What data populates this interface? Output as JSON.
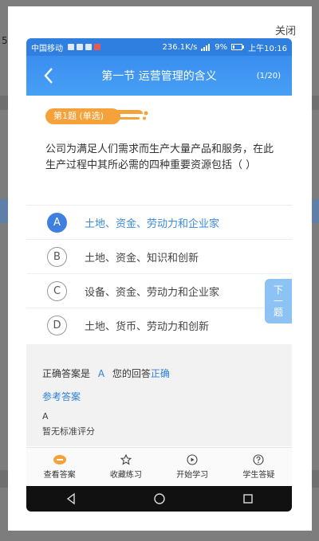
{
  "background": {
    "side_text": "5"
  },
  "modal": {
    "close_label": "关闭"
  },
  "status_bar": {
    "carrier": "中国移动",
    "net_speed": "236.1K/s",
    "battery": "9%",
    "time": "上午10:16"
  },
  "header": {
    "title": "第一节 运营管理的含义",
    "counter": "(1/20)"
  },
  "question": {
    "badge": "第1题 (单选)",
    "text": "公司为满足人们需求而生产大量产品和服务，在此生产过程中其所必需的四种重要资源包括（ ）",
    "options": [
      {
        "letter": "A",
        "text": "土地、资金、劳动力和企业家",
        "selected": true
      },
      {
        "letter": "B",
        "text": "土地、资金、知识和创新",
        "selected": false
      },
      {
        "letter": "C",
        "text": "设备、资金、劳动力和企业家",
        "selected": false
      },
      {
        "letter": "D",
        "text": "土地、货币、劳动力和创新",
        "selected": false
      }
    ],
    "next_label_1": "下",
    "next_label_2": "一",
    "next_label_3": "题"
  },
  "answer": {
    "correct_prefix": "正确答案是",
    "correct_letter": "A",
    "your_answer_prefix": "您的回答",
    "your_answer_result": "正确",
    "reference_label": "参考答案",
    "reference_value": "A",
    "scoring_note": "暂无标准评分"
  },
  "bottom_nav": {
    "items": [
      {
        "label": "查看答案",
        "icon": "answer-icon"
      },
      {
        "label": "收藏练习",
        "icon": "star-icon"
      },
      {
        "label": "开始学习",
        "icon": "play-icon"
      },
      {
        "label": "学生答疑",
        "icon": "question-icon"
      }
    ]
  },
  "colors": {
    "brand_blue": "#3a8ef0",
    "badge_orange": "#f5a23b",
    "selected_blue": "#3f7fe0"
  }
}
